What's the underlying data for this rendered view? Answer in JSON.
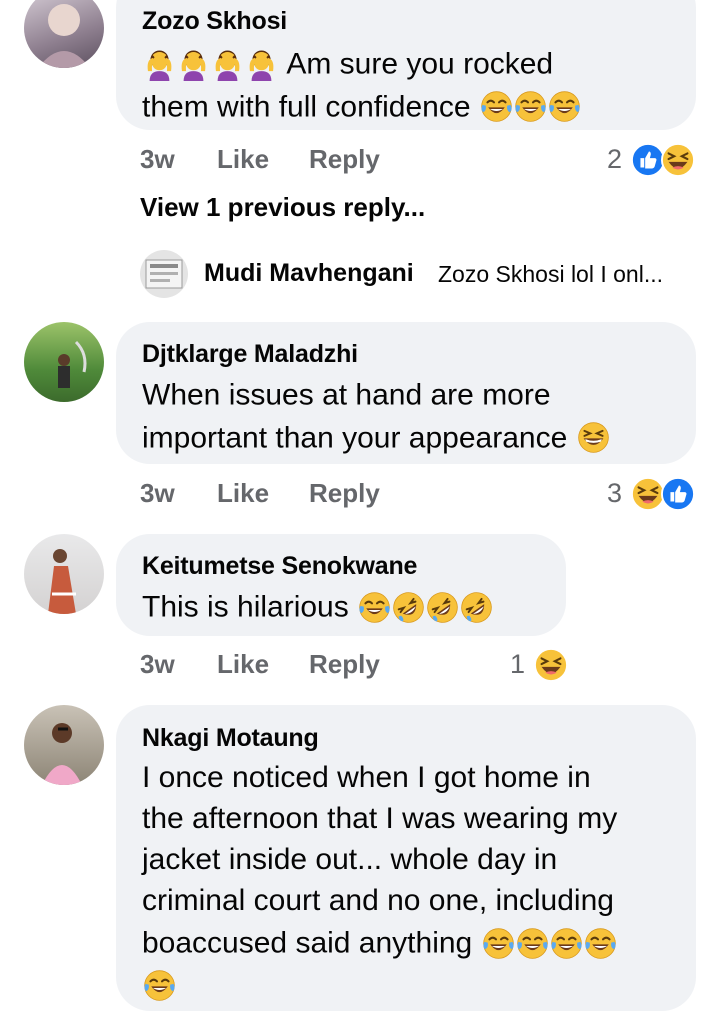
{
  "comments": [
    {
      "author": "Zozo Skhosi",
      "line1": "Am sure you rocked",
      "line2": "them with full confidence",
      "time": "3w",
      "like": "Like",
      "reply": "Reply",
      "reaction_count": "2",
      "reactions": [
        "like-icon",
        "laugh-icon"
      ]
    },
    {
      "author": "Djtklarge Maladzhi",
      "line1": "When issues at hand are more",
      "line2": "important than your appearance",
      "time": "3w",
      "like": "Like",
      "reply": "Reply",
      "reaction_count": "3",
      "reactions": [
        "laugh-icon",
        "like-icon"
      ]
    },
    {
      "author": "Keitumetse Senokwane",
      "line1": "This is hilarious",
      "time": "3w",
      "like": "Like",
      "reply": "Reply",
      "reaction_count": "1",
      "reactions": [
        "laugh-icon"
      ]
    },
    {
      "author": "Nkagi Motaung",
      "lines": [
        "I once noticed when I got home in",
        "the afternoon that I was wearing my",
        "jacket inside out... whole day in",
        "criminal court and no one, including",
        "boaccused said anything"
      ]
    }
  ],
  "view_previous": "View 1 previous reply...",
  "reply_preview": {
    "author": "Mudi Mavhengani",
    "snippet": "Zozo Skhosi lol I onl..."
  },
  "colors": {
    "bubble": "#f0f2f5",
    "muted": "#65676b",
    "like_blue": "#1877f2",
    "emoji_yellow": "#f7c23a"
  }
}
